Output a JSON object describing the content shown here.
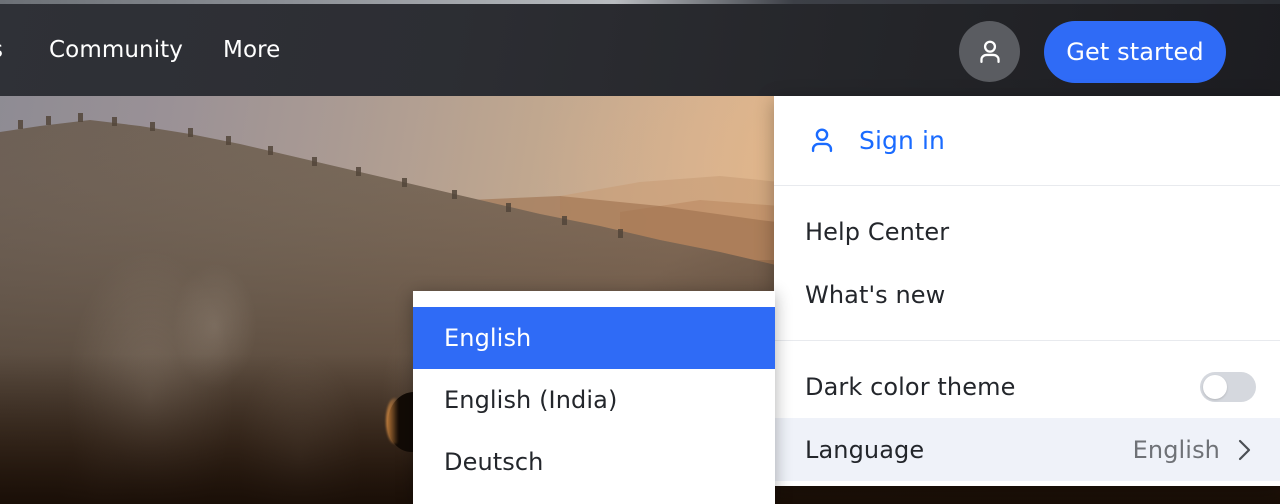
{
  "navbar": {
    "partial_item": "s",
    "items": [
      {
        "label": "Community",
        "name": "nav-link-community"
      },
      {
        "label": "More",
        "name": "nav-link-more"
      }
    ],
    "avatar_icon": "person-icon",
    "get_started_label": "Get started"
  },
  "account_menu": {
    "sign_in": {
      "label": "Sign in",
      "icon": "person-icon",
      "color": "#1a6bff"
    },
    "links": [
      {
        "label": "Help Center"
      },
      {
        "label": "What's new"
      }
    ],
    "settings": [
      {
        "label": "Dark color theme",
        "control": "toggle",
        "value": "off"
      },
      {
        "label": "Language",
        "control": "submenu",
        "value": "English",
        "icon": "chevron-right-icon",
        "highlighted": true
      }
    ]
  },
  "language_submenu": {
    "items": [
      {
        "label": "English",
        "selected": true
      },
      {
        "label": "English (India)",
        "selected": false
      },
      {
        "label": "Deutsch",
        "selected": false
      }
    ]
  },
  "colors": {
    "accent_blue": "#2f6bf6",
    "link_blue": "#1a6bff",
    "menu_bg": "#ffffff",
    "row_highlight": "#eff2f9",
    "muted_text": "#6f7277",
    "navbar_bg": "#2c2e34"
  },
  "background": {
    "description": "sunset mountain cliff landscape photo"
  }
}
